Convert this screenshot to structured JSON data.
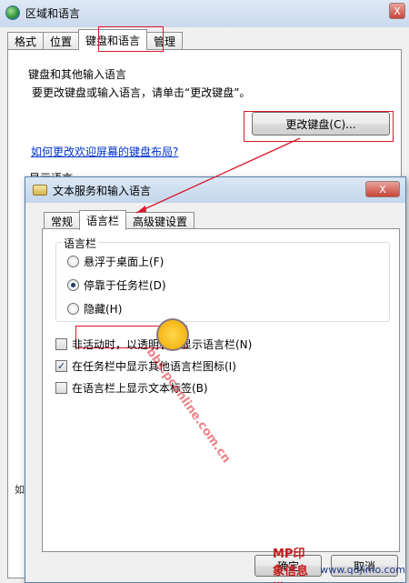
{
  "back_window": {
    "title": "区域和语言",
    "close": "X",
    "tabs": [
      {
        "label": "格式"
      },
      {
        "label": "位置"
      },
      {
        "label": "键盘和语言"
      },
      {
        "label": "管理"
      }
    ],
    "group_title": "键盘和其他输入语言",
    "group_desc": "要更改键盘或输入语言，请单击“更改键盘”。",
    "change_keyboard_label": "更改键盘(C)...",
    "welcome_link": "如何更改欢迎屏幕的键盘布局?",
    "display_lang_title": "显示语言",
    "side_fragment": "如"
  },
  "front_window": {
    "title": "文本服务和输入语言",
    "close": "X",
    "tabs": [
      {
        "label": "常规"
      },
      {
        "label": "语言栏"
      },
      {
        "label": "高级键设置"
      }
    ],
    "group_title": "语言栏",
    "radios": [
      {
        "label": "悬浮于桌面上(F)",
        "checked": false
      },
      {
        "label": "停靠于任务栏(D)",
        "checked": true
      },
      {
        "label": "隐藏(H)",
        "checked": false
      }
    ],
    "checks": [
      {
        "label": "非活动时，以透明状态显示语言栏(N)",
        "checked": false,
        "mark": ""
      },
      {
        "label": "在任务栏中显示其他语言栏图标(I)",
        "checked": true,
        "mark": "✓"
      },
      {
        "label": "在语言栏上显示文本标签(B)",
        "checked": false,
        "mark": ""
      }
    ],
    "ok_label": "确定",
    "cancel_label": "取消"
  },
  "watermark": {
    "text": "bbs.pconline.com.cn"
  },
  "footer_logo": {
    "brand": "MP印象信息港",
    "url": "www.qdjimo.com"
  },
  "colors": {
    "highlight": "#d9182b",
    "link": "#0033cc"
  }
}
